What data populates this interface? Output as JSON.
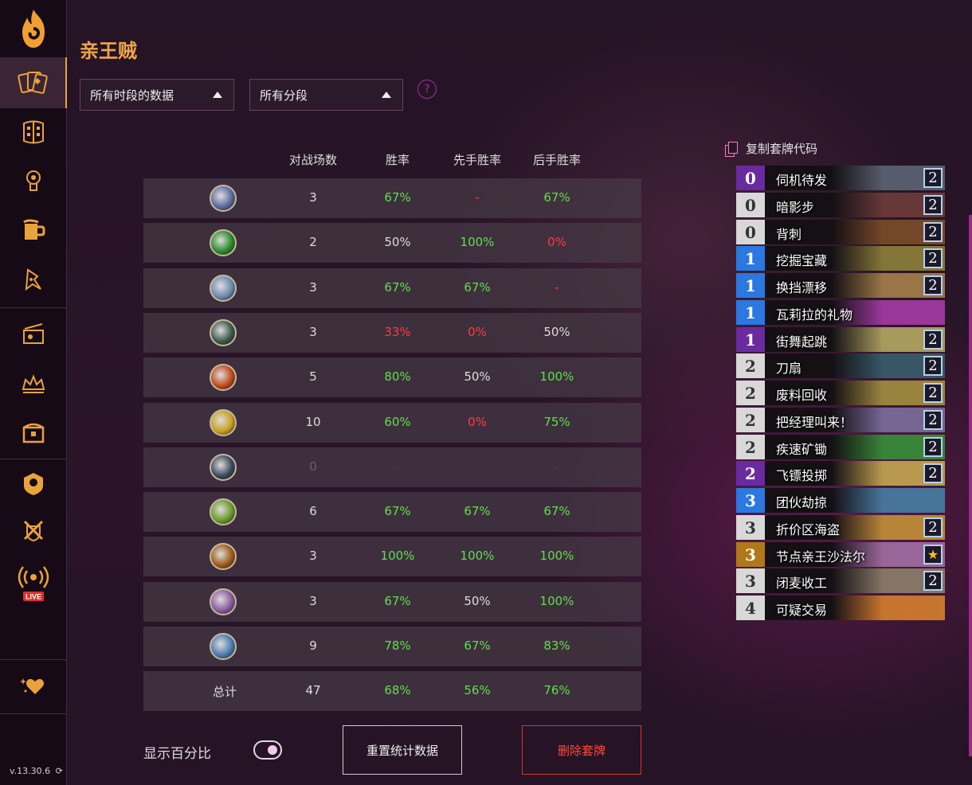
{
  "sidebar": {
    "items": [
      {
        "name": "decks-icon"
      },
      {
        "name": "cards-icon"
      },
      {
        "name": "mulligan-icon"
      },
      {
        "name": "tavern-icon"
      },
      {
        "name": "battlegrounds-icon"
      },
      {
        "name": "tickets-icon"
      },
      {
        "name": "crown-icon"
      },
      {
        "name": "chest-icon"
      },
      {
        "name": "hero-icon"
      },
      {
        "name": "arena-icon"
      },
      {
        "name": "live-icon"
      },
      {
        "name": "favorite-icon"
      }
    ],
    "live_label": "LIVE",
    "version": "v.13.30.6"
  },
  "page_title": "亲王贼",
  "filters": {
    "time": "所有时段的数据",
    "rank": "所有分段",
    "help": "?"
  },
  "table": {
    "headers": [
      "对战场数",
      "胜率",
      "先手胜率",
      "后手胜率"
    ],
    "rows": [
      {
        "icon_color": "#5a6aa0",
        "games": "3",
        "winrate": "67%",
        "first": "-",
        "second": "67%"
      },
      {
        "icon_color": "#2a8a2a",
        "games": "2",
        "winrate": "50%",
        "first": "100%",
        "second": "0%"
      },
      {
        "icon_color": "#6a8ab0",
        "games": "3",
        "winrate": "67%",
        "first": "67%",
        "second": "-"
      },
      {
        "icon_color": "#3a5a4a",
        "games": "3",
        "winrate": "33%",
        "first": "0%",
        "second": "50%"
      },
      {
        "icon_color": "#c04a1a",
        "games": "5",
        "winrate": "80%",
        "first": "50%",
        "second": "100%"
      },
      {
        "icon_color": "#c8a020",
        "games": "10",
        "winrate": "60%",
        "first": "0%",
        "second": "75%"
      },
      {
        "icon_color": "#3a4a5a",
        "games": "0",
        "winrate": "-",
        "first": "-",
        "second": "-"
      },
      {
        "icon_color": "#6a9a2a",
        "games": "6",
        "winrate": "67%",
        "first": "67%",
        "second": "67%"
      },
      {
        "icon_color": "#a05a1a",
        "games": "3",
        "winrate": "100%",
        "first": "100%",
        "second": "100%"
      },
      {
        "icon_color": "#8a5aa0",
        "games": "3",
        "winrate": "67%",
        "first": "50%",
        "second": "100%"
      },
      {
        "icon_color": "#4a7ab0",
        "games": "9",
        "winrate": "78%",
        "first": "67%",
        "second": "83%"
      }
    ],
    "total": {
      "label": "总计",
      "games": "47",
      "winrate": "68%",
      "first": "56%",
      "second": "76%"
    }
  },
  "controls": {
    "show_percent": "显示百分比",
    "reset": "重置统计数据",
    "delete": "删除套牌"
  },
  "deck": {
    "copy_label": "复制套牌代码",
    "cards": [
      {
        "cost": "0",
        "name": "伺机待发",
        "count": "2",
        "rarity": "epic",
        "art": "#5a6070"
      },
      {
        "cost": "0",
        "name": "暗影步",
        "count": "2",
        "rarity": "common",
        "art": "#6a3a3a"
      },
      {
        "cost": "0",
        "name": "背刺",
        "count": "2",
        "rarity": "common",
        "art": "#7a4a2a"
      },
      {
        "cost": "1",
        "name": "挖掘宝藏",
        "count": "2",
        "rarity": "rare",
        "art": "#8a7a3a"
      },
      {
        "cost": "1",
        "name": "换挡漂移",
        "count": "2",
        "rarity": "rare",
        "art": "#a07a4a"
      },
      {
        "cost": "1",
        "name": "瓦莉拉的礼物",
        "count": "",
        "rarity": "rare",
        "art": "#a03aa0"
      },
      {
        "cost": "1",
        "name": "街舞起跳",
        "count": "2",
        "rarity": "epic",
        "art": "#b0a060"
      },
      {
        "cost": "2",
        "name": "刀扇",
        "count": "2",
        "rarity": "common",
        "art": "#3a5a6a"
      },
      {
        "cost": "2",
        "name": "废料回收",
        "count": "2",
        "rarity": "common",
        "art": "#a08a40"
      },
      {
        "cost": "2",
        "name": "把经理叫来！",
        "count": "2",
        "rarity": "common",
        "art": "#7a6a9a"
      },
      {
        "cost": "2",
        "name": "疾速矿锄",
        "count": "2",
        "rarity": "common",
        "art": "#3a8a3a"
      },
      {
        "cost": "2",
        "name": "飞镖投掷",
        "count": "2",
        "rarity": "epic",
        "art": "#c0a050"
      },
      {
        "cost": "3",
        "name": "团伙劫掠",
        "count": "",
        "rarity": "rare",
        "art": "#4a7aa0"
      },
      {
        "cost": "3",
        "name": "折价区海盗",
        "count": "2",
        "rarity": "common",
        "art": "#c08a3a"
      },
      {
        "cost": "3",
        "name": "节点亲王沙法尔",
        "count": "★",
        "rarity": "legendary",
        "art": "#a06aa0"
      },
      {
        "cost": "3",
        "name": "闭麦收工",
        "count": "2",
        "rarity": "common",
        "art": "#8a7a6a"
      },
      {
        "cost": "4",
        "name": "可疑交易",
        "count": "",
        "rarity": "common",
        "art": "#d07a30"
      }
    ],
    "rarity_colors": {
      "common": "#d8d8d8",
      "rare": "#2a78e0",
      "epic": "#6a2aa0",
      "legendary": "#b07818"
    }
  }
}
